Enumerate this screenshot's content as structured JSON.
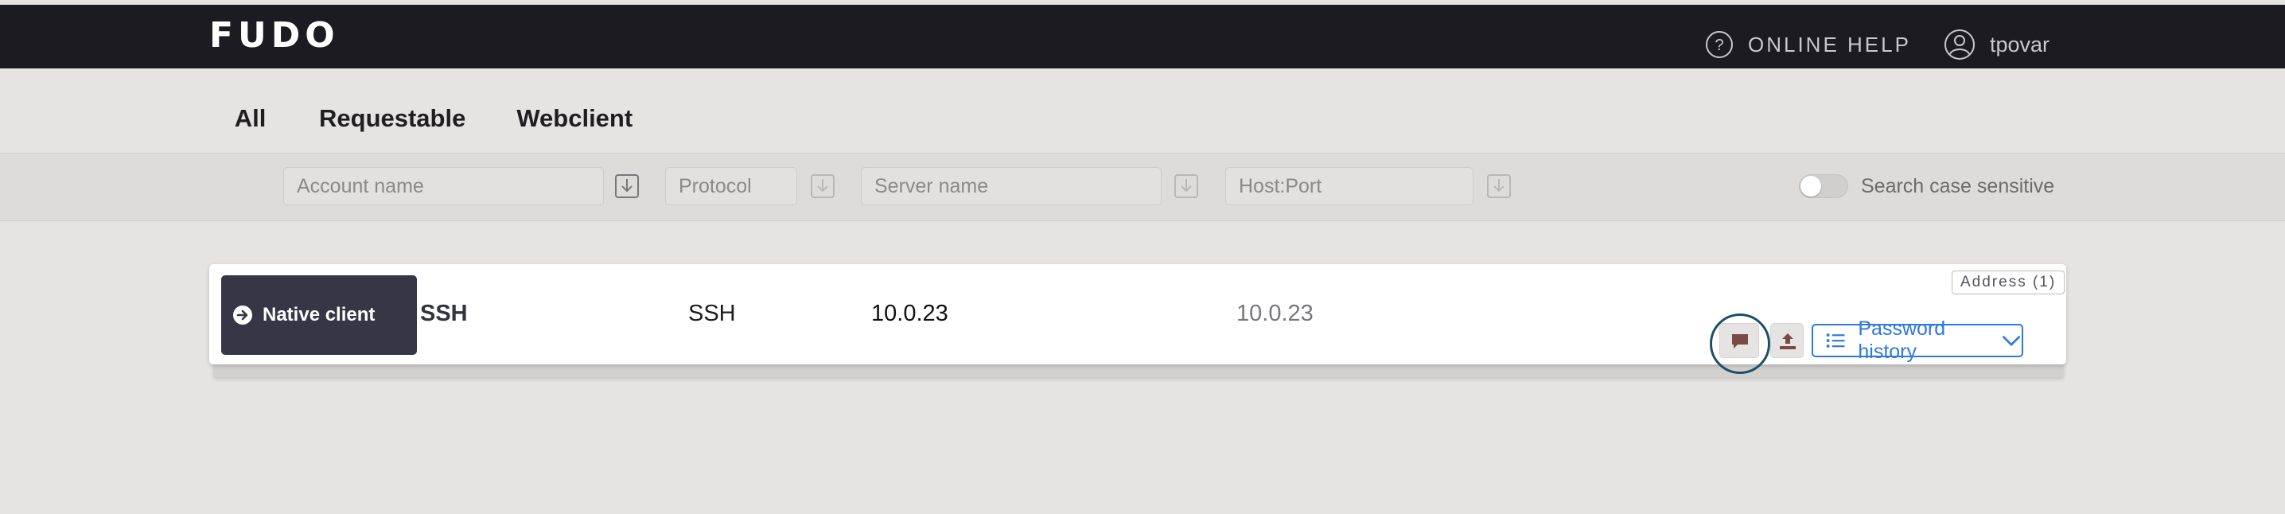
{
  "app": {
    "logo": "FUDO"
  },
  "header": {
    "help_label": "ONLINE HELP",
    "username": "tpovar"
  },
  "tabs": [
    {
      "label": "All",
      "active": true
    },
    {
      "label": "Requestable",
      "active": false
    },
    {
      "label": "Webclient",
      "active": false
    }
  ],
  "filters": {
    "account_placeholder": "Account name",
    "protocol_placeholder": "Protocol",
    "server_placeholder": "Server name",
    "host_placeholder": "Host:Port",
    "case_sensitive_label": "Search case sensitive",
    "case_sensitive": false
  },
  "row": {
    "native_label": "Native client",
    "account": "SSH",
    "protocol": "SSH",
    "server": "10.0.23",
    "host": "10.0.23",
    "address_badge": "Address (1)",
    "password_history_label": "Password history"
  },
  "colors": {
    "topbar": "#1c1b21",
    "accent": "#2f78e0",
    "native_button": "#363646",
    "focus_ring": "#1e4f69",
    "icon_brown": "#7a4a44"
  },
  "icons": {
    "help": "question-circle-icon",
    "user": "user-circle-icon",
    "native": "arrow-right-circle-icon",
    "comment": "comment-icon",
    "upload": "upload-icon",
    "list": "list-icon",
    "chevron": "chevron-down-icon",
    "sort": "sort-down-icon"
  }
}
